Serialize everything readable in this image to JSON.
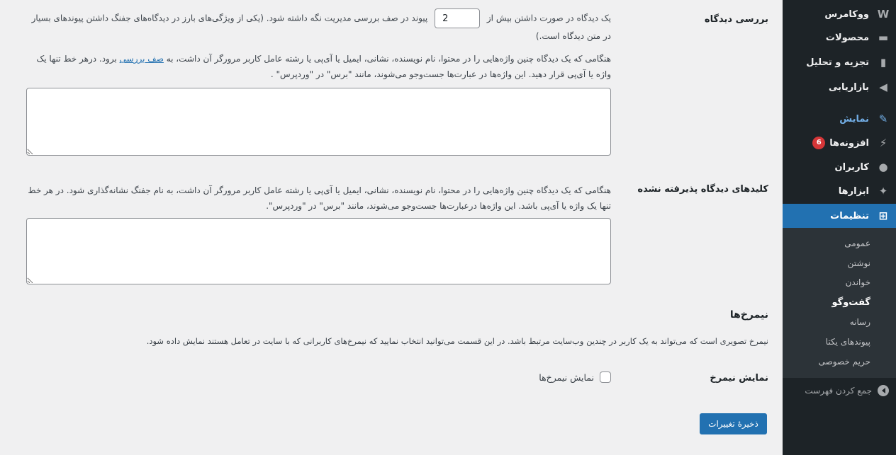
{
  "sidebar": {
    "items": [
      {
        "label": "ووکامرس",
        "icon": "woo-icon",
        "glyph": "W"
      },
      {
        "label": "محصولات",
        "icon": "archive-icon",
        "glyph": "▬"
      },
      {
        "label": "تجزیه و تحلیل",
        "icon": "bar-chart-icon",
        "glyph": "▮"
      },
      {
        "label": "بازاریابی",
        "icon": "megaphone-icon",
        "glyph": "◀"
      },
      {
        "label": "نمایش",
        "icon": "paintbrush-icon",
        "glyph": "✎"
      },
      {
        "label": "افزونه‌ها",
        "icon": "plugin-icon",
        "glyph": "⚡",
        "badge": "6"
      },
      {
        "label": "کاربران",
        "icon": "user-icon",
        "glyph": "●"
      },
      {
        "label": "ابزارها",
        "icon": "wrench-icon",
        "glyph": "✦"
      },
      {
        "label": "تنظیمات",
        "icon": "settings-icon",
        "glyph": "⊞"
      }
    ],
    "submenu": [
      "عمومی",
      "نوشتن",
      "خواندن",
      "گفت‌وگو",
      "رسانه",
      "پیوندهای یکتا",
      "حریم خصوصی"
    ],
    "collapse_label": "جمع کردن فهرست"
  },
  "moderation": {
    "heading": "بررسی دیدگاه",
    "line1_before": "یک دیدگاه در صورت داشتن بیش از",
    "links_value": "2",
    "line1_after": "پیوند در صف بررسی مدیریت نگه داشته شود. (یکی از ویژگی‌های بارز در دیدگاه‌های جفنگ داشتن پیوندهای بسیار در متن دیدگاه است.)",
    "desc_before_link": "هنگامی که یک دیدگاه چنین واژه‌هایی را در محتوا، نام نویسنده، نشانی، ایمیل یا آی‌پی یا رشته عامل کاربر مرورگر آن داشت، به",
    "desc_link": "صف بررسی",
    "desc_after_link": "برود. درهر خط تنها یک واژه یا آی‌پی قرار دهید. این واژه‌ها در عبارت‌ها جست‌وجو می‌شوند، مانند \"برس\" در \"وردپرس\" ."
  },
  "disallowed": {
    "heading": "کلیدهای دیدگاه پذیرفته نشده",
    "desc": "هنگامی که یک دیدگاه چنین واژه‌هایی را در محتوا، نام نویسنده، نشانی، ایمیل یا آی‌پی یا رشته عامل کاربر مرورگر آن داشت، به نام جفنگ نشانه‌گذاری شود. در هر خط تنها یک واژه یا آی‌پی باشد. این واژه‌ها درعبارت‌ها جست‌وجو می‌شوند، مانند \"برس\" در \"وردپرس\"."
  },
  "avatars": {
    "heading": "نیمرخ‌ها",
    "desc": "نیمرخ تصویری است که می‌تواند به یک کاربر در چندین وب‌سایت مرتبط باشد. در این قسمت می‌توانید انتخاب نمایید که نیمرخ‌های کاربرانی که با سایت در تعامل هستند نمایش داده شود.",
    "show_heading": "نمایش نیمرخ",
    "show_label": "نمایش نیمرخ‌ها"
  },
  "save_label": "ذخیرهٔ تغییرات"
}
